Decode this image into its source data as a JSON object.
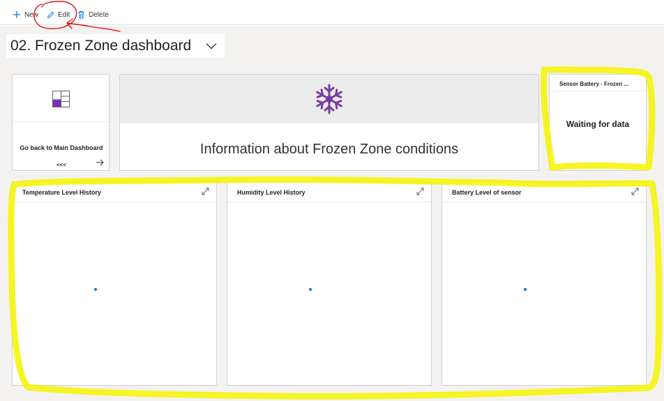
{
  "toolbar": {
    "new_label": "New",
    "edit_label": "Edit",
    "delete_label": "Delete"
  },
  "dashboard": {
    "title": "02. Frozen Zone dashboard"
  },
  "tiles": {
    "nav": {
      "label": "Go back to Main Dashboard",
      "sub": "<<<"
    },
    "info": {
      "text": "Information about Frozen Zone conditions"
    },
    "kpi": {
      "title": "Sensor Battery - Frozen ...",
      "value": "Waiting for data"
    },
    "charts": [
      {
        "title": "Temperature Level History"
      },
      {
        "title": "Humidity Level History"
      },
      {
        "title": "Battery Level of sensor"
      }
    ]
  },
  "colors": {
    "accent": "#0078d4",
    "snowflake": "#7a3aa0",
    "annotation_yellow": "#f5f500",
    "annotation_red": "#e01010"
  },
  "icons": [
    "plus-icon",
    "pencil-icon",
    "trash-icon",
    "chevron-down-icon",
    "dashboard-icon",
    "arrow-right-icon",
    "snowflake-icon",
    "expand-icon"
  ]
}
